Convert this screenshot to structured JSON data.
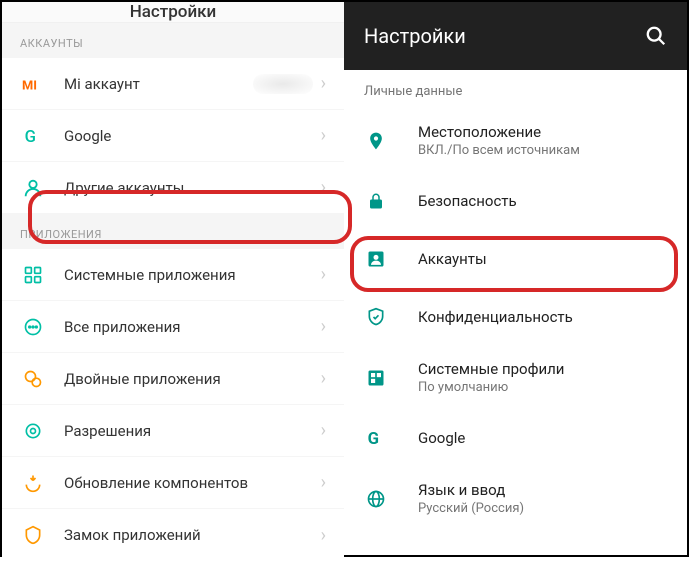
{
  "miui": {
    "title": "Настройки",
    "sections": {
      "accounts_header": "АККАУНТЫ",
      "apps_header": "ПРИЛОЖЕНИЯ"
    },
    "items": {
      "mi_account": "Mi аккаунт",
      "google": "Google",
      "other_accounts": "Другие аккаунты",
      "system_apps": "Системные приложения",
      "all_apps": "Все приложения",
      "dual_apps": "Двойные приложения",
      "permissions": "Разрешения",
      "component_update": "Обновление компонентов",
      "app_lock": "Замок приложений"
    }
  },
  "android": {
    "title": "Настройки",
    "section": "Личные данные",
    "items": {
      "location": {
        "label": "Местоположение",
        "sub": "ВКЛ./По всем источникам"
      },
      "security": {
        "label": "Безопасность"
      },
      "accounts": {
        "label": "Аккаунты"
      },
      "privacy": {
        "label": "Конфиденциальность"
      },
      "profiles": {
        "label": "Системные профили",
        "sub": "По умолчанию"
      },
      "google": {
        "label": "Google"
      },
      "language": {
        "label": "Язык и ввод",
        "sub": "Русский (Россия)"
      }
    }
  },
  "colors": {
    "teal": "#009688",
    "miui_orange": "#ff6900",
    "miui_teal": "#00bfa5",
    "highlight": "#d62828"
  }
}
